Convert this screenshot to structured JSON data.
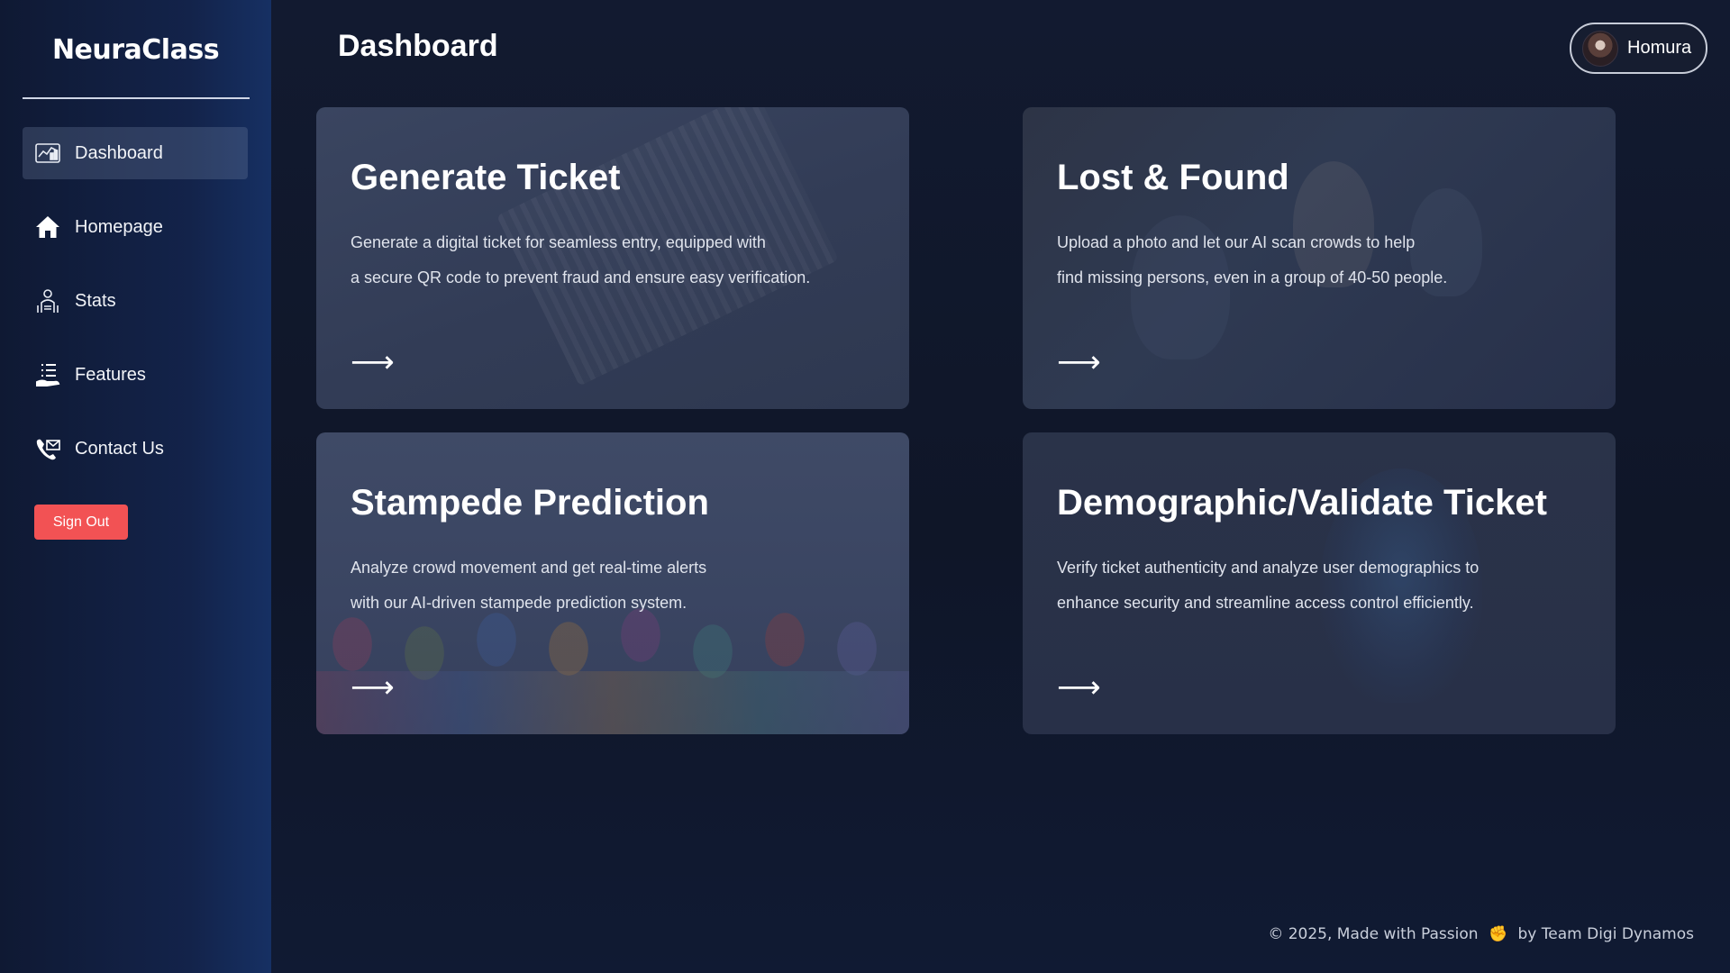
{
  "brand": "NeuraClass",
  "sidebar": {
    "items": [
      {
        "label": "Dashboard",
        "icon": "dashboard-icon",
        "active": true
      },
      {
        "label": "Homepage",
        "icon": "home-icon"
      },
      {
        "label": "Stats",
        "icon": "stats-icon"
      },
      {
        "label": "Features",
        "icon": "features-icon"
      },
      {
        "label": "Contact Us",
        "icon": "contact-icon"
      }
    ],
    "signout_label": "Sign Out"
  },
  "header": {
    "title": "Dashboard",
    "user_name": "Homura"
  },
  "cards": [
    {
      "title": "Generate Ticket",
      "line1": "Generate a digital ticket for seamless entry, equipped with",
      "line2": "a secure QR code to prevent fraud and ensure easy verification.",
      "arrow": "⟶"
    },
    {
      "title": "Lost & Found",
      "line1": "Upload a photo and let our AI scan crowds to help",
      "line2": "find missing persons, even in a group of 40-50 people.",
      "arrow": "⟶"
    },
    {
      "title": "Stampede Prediction",
      "line1": "Analyze crowd movement and get real-time alerts",
      "line2": "with our AI-driven stampede prediction system.",
      "arrow": "⟶"
    },
    {
      "title": "Demographic/Validate Ticket",
      "line1": "Verify ticket authenticity and analyze user demographics to",
      "line2": "enhance security and streamline access control efficiently.",
      "arrow": "⟶"
    }
  ],
  "footer": {
    "text_before": "© 2025, Made with Passion",
    "emoji": "✊",
    "text_after": "by Team Digi Dynamos"
  },
  "colors": {
    "accent_signout": "#f25254",
    "sidebar_bg": "#13234a",
    "main_bg": "#0f1628"
  }
}
